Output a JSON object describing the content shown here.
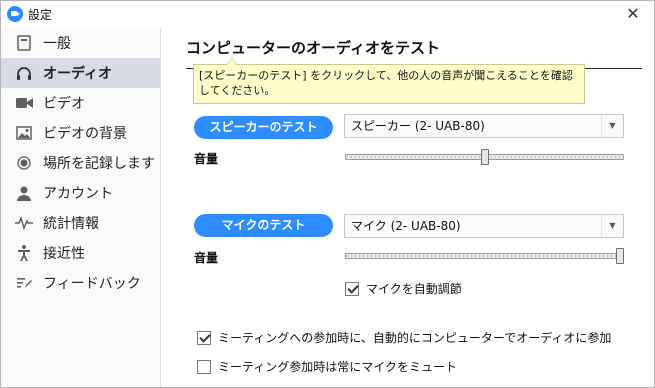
{
  "window": {
    "title": "設定",
    "close_glyph": "✕"
  },
  "sidebar": {
    "items": [
      {
        "label": "一般",
        "icon": "general-icon",
        "active": false
      },
      {
        "label": "オーディオ",
        "icon": "headphones-icon",
        "active": true
      },
      {
        "label": "ビデオ",
        "icon": "video-camera-icon",
        "active": false
      },
      {
        "label": "ビデオの背景",
        "icon": "image-icon",
        "active": false
      },
      {
        "label": "場所を記録します",
        "icon": "record-icon",
        "active": false
      },
      {
        "label": "アカウント",
        "icon": "person-icon",
        "active": false
      },
      {
        "label": "統計情報",
        "icon": "pulse-icon",
        "active": false
      },
      {
        "label": "接近性",
        "icon": "accessibility-icon",
        "active": false
      },
      {
        "label": "フィードバック",
        "icon": "feedback-icon",
        "active": false
      }
    ]
  },
  "main": {
    "heading": "コンピューターのオーディオをテスト",
    "tooltip": "[スピーカーのテスト] をクリックして、他の人の音声が聞こえることを確認してください。",
    "speaker": {
      "test_button": "スピーカーのテスト",
      "device": "スピーカー (2- UAB-80)",
      "volume_label": "音量",
      "volume": 0.5
    },
    "mic": {
      "test_button": "マイクのテスト",
      "device": "マイク (2- UAB-80)",
      "volume_label": "音量",
      "volume": 1.0,
      "auto_adjust_label": "マイクを自動調節",
      "auto_adjust_checked": true
    },
    "options": [
      {
        "label": "ミーティングへの参加時に、自動的にコンピューターでオーディオに参加",
        "checked": true
      },
      {
        "label": "ミーティング参加時は常にマイクをミュート",
        "checked": false
      }
    ],
    "dropdown_glyph": "▼"
  },
  "colors": {
    "accent": "#2d8cff",
    "sidebar_active": "#d6dbe5",
    "tooltip_bg": "#ffffcc"
  }
}
